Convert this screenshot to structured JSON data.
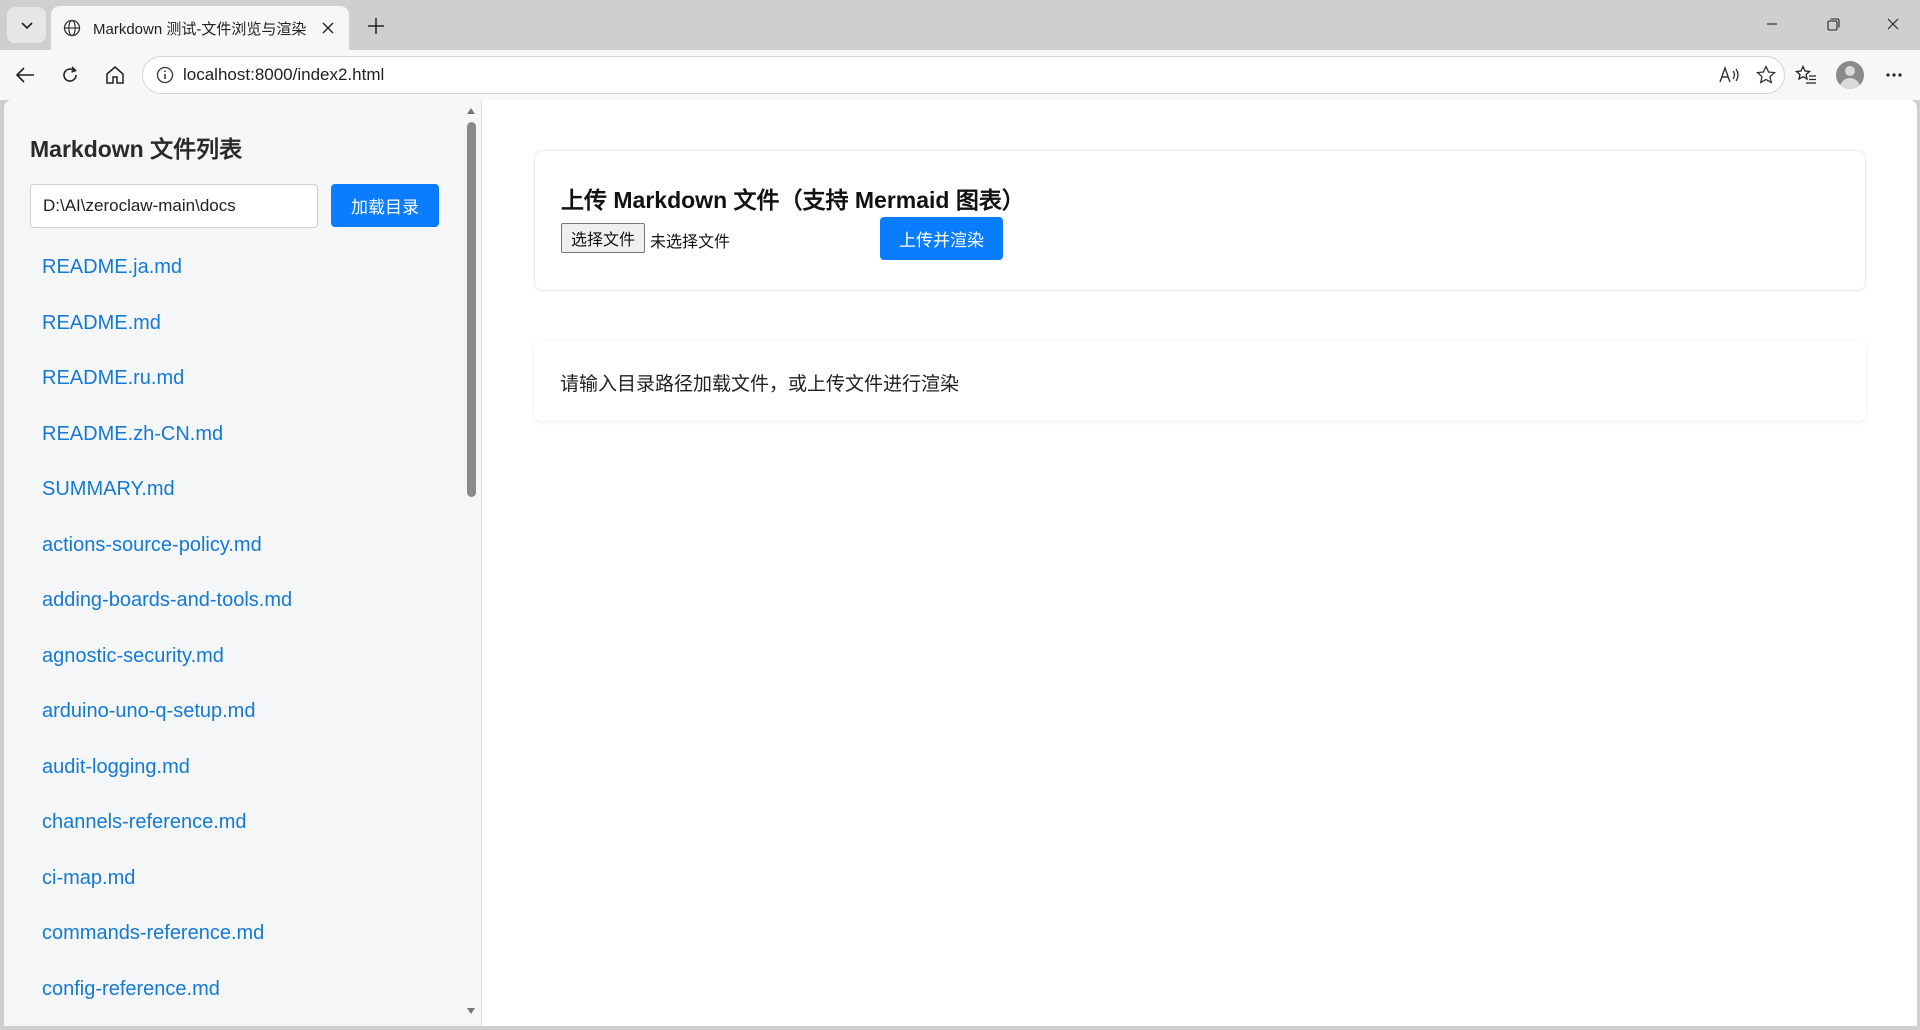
{
  "browser": {
    "tab_title": "Markdown 测试-文件浏览与渲染",
    "url": "localhost:8000/index2.html"
  },
  "sidebar": {
    "title": "Markdown 文件列表",
    "dir_input_value": "D:\\AI\\zeroclaw-main\\docs",
    "load_button": "加载目录",
    "files": [
      "README.ja.md",
      "README.md",
      "README.ru.md",
      "README.zh-CN.md",
      "SUMMARY.md",
      "actions-source-policy.md",
      "adding-boards-and-tools.md",
      "agnostic-security.md",
      "arduino-uno-q-setup.md",
      "audit-logging.md",
      "channels-reference.md",
      "ci-map.md",
      "commands-reference.md",
      "config-reference.md"
    ]
  },
  "upload": {
    "title": "上传 Markdown 文件（支持 Mermaid 图表）",
    "choose_file_button": "选择文件",
    "no_file_text": "未选择文件",
    "upload_button": "上传并渲染"
  },
  "content": {
    "placeholder": "请输入目录路径加载文件，或上传文件进行渲染"
  },
  "colors": {
    "accent": "#0a7cff",
    "link": "#1479d4",
    "sidebar_bg": "#f5f6f7"
  }
}
